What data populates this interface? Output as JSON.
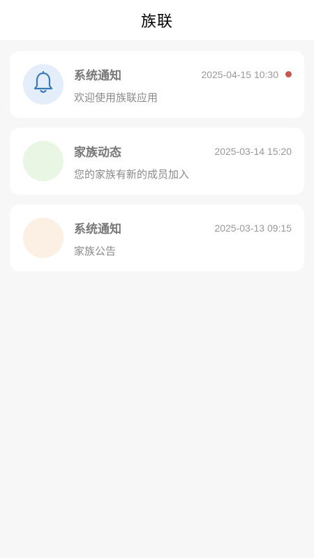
{
  "header": {
    "title": "族联"
  },
  "colors": {
    "unread_dot": "#c9564a",
    "avatar_blue": "#e4eefb",
    "avatar_green": "#eaf6e4",
    "avatar_orange": "#fcefe4",
    "bell_stroke": "#3b78b8"
  },
  "messages": [
    {
      "title": "系统通知",
      "time": "2025-04-15 10:30",
      "preview": "欢迎使用族联应用",
      "icon": "bell-icon",
      "unread": true
    },
    {
      "title": "家族动态",
      "time": "2025-03-14 15:20",
      "preview": "您的家族有新的成员加入",
      "icon": "",
      "unread": false
    },
    {
      "title": "系统通知",
      "time": "2025-03-13 09:15",
      "preview": "家族公告",
      "icon": "",
      "unread": false
    }
  ]
}
